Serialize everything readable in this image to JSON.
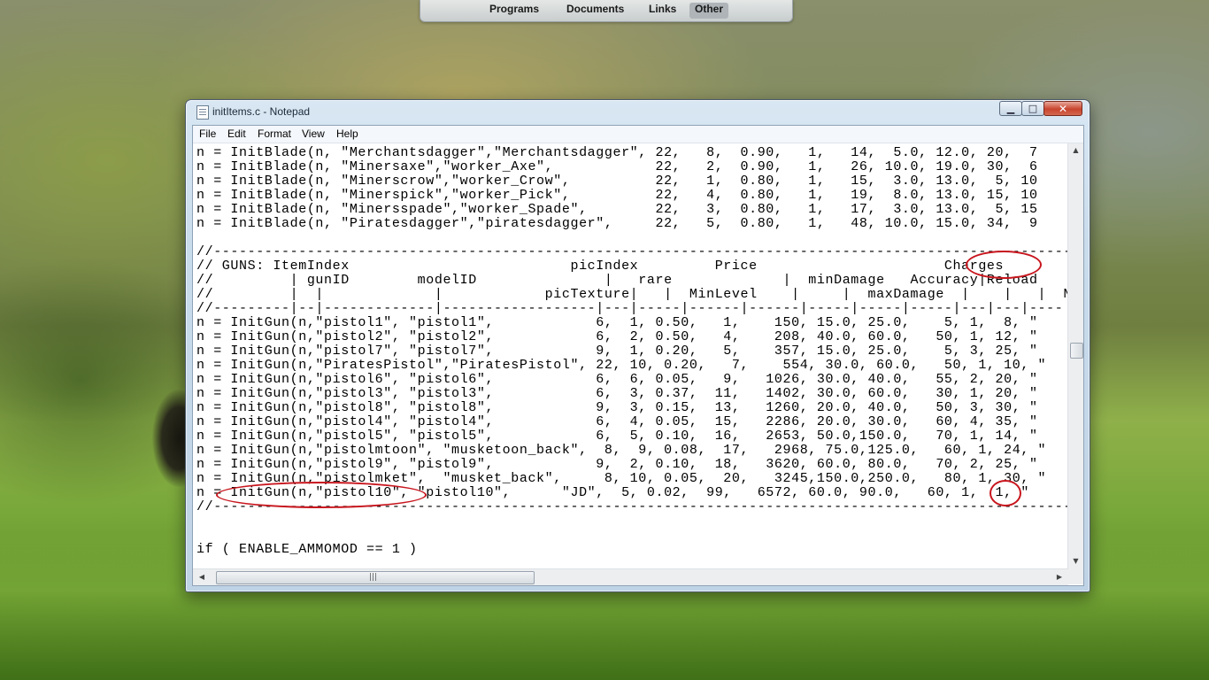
{
  "launcher": {
    "tabs": [
      {
        "label": "Programs",
        "active": false
      },
      {
        "label": "Documents",
        "active": false
      },
      {
        "label": "Links",
        "active": false
      },
      {
        "label": "Other",
        "active": true
      }
    ]
  },
  "window": {
    "title": "initItems.c - Notepad",
    "icon": "notepad-icon",
    "buttons": {
      "minimize": "minimize-icon",
      "maximize": "maximize-icon",
      "close": "close-icon"
    }
  },
  "menu": {
    "items": [
      "File",
      "Edit",
      "Format",
      "View",
      "Help"
    ]
  },
  "editor": {
    "lines": [
      "n = InitBlade(n, \"Merchantsdagger\",\"Merchantsdagger\", 22,   8,  0.90,   1,   14,  5.0, 12.0, 20,  7",
      "n = InitBlade(n, \"Minersaxe\",\"worker_Axe\",            22,   2,  0.90,   1,   26, 10.0, 19.0, 30,  6",
      "n = InitBlade(n, \"Minerscrow\",\"worker_Crow\",          22,   1,  0.80,   1,   15,  3.0, 13.0,  5, 10",
      "n = InitBlade(n, \"Minerspick\",\"worker_Pick\",          22,   4,  0.80,   1,   19,  8.0, 13.0, 15, 10",
      "n = InitBlade(n, \"Minersspade\",\"worker_Spade\",        22,   3,  0.80,   1,   17,  3.0, 13.0,  5, 15",
      "n = InitBlade(n, \"Piratesdagger\",\"piratesdagger\",     22,   5,  0.80,   1,   48, 10.0, 15.0, 34,  9",
      "",
      "//------------------------------------------------------------------------------------------------------",
      "// GUNS: ItemIndex                          picIndex         Price                      Charges",
      "//         | gunID        modelID               |   rare             |  minDamage   Accuracy|Reload",
      "//         |  |             |            picTexture|   |  MinLevel    |     |  maxDamage  |    |   |  Na",
      "//---------|--|-------------|------------------|---|-----|------|------|-----|-----|-----|---|---|----",
      "n = InitGun(n,\"pistol1\", \"pistol1\",            6,  1, 0.50,   1,    150, 15.0, 25.0,    5, 1,  8, \"",
      "n = InitGun(n,\"pistol2\", \"pistol2\",            6,  2, 0.50,   4,    208, 40.0, 60.0,   50, 1, 12, \"",
      "n = InitGun(n,\"pistol7\", \"pistol7\",            9,  1, 0.20,   5,    357, 15.0, 25.0,    5, 3, 25, \"",
      "n = InitGun(n,\"PiratesPistol\",\"PiratesPistol\", 22, 10, 0.20,   7,    554, 30.0, 60.0,   50, 1, 10, \"",
      "n = InitGun(n,\"pistol6\", \"pistol6\",            6,  6, 0.05,   9,   1026, 30.0, 40.0,   55, 2, 20, \"",
      "n = InitGun(n,\"pistol3\", \"pistol3\",            6,  3, 0.37,  11,   1402, 30.0, 60.0,   30, 1, 20, \"",
      "n = InitGun(n,\"pistol8\", \"pistol8\",            9,  3, 0.15,  13,   1260, 20.0, 40.0,   50, 3, 30, \"",
      "n = InitGun(n,\"pistol4\", \"pistol4\",            6,  4, 0.05,  15,   2286, 20.0, 30.0,   60, 4, 35, \"",
      "n = InitGun(n,\"pistol5\", \"pistol5\",            6,  5, 0.10,  16,   2653, 50.0,150.0,   70, 1, 14, \"",
      "n = InitGun(n,\"pistolmtoon\", \"musketoon_back\",  8,  9, 0.08,  17,   2968, 75.0,125.0,   60, 1, 24, \"",
      "n = InitGun(n,\"pistol9\", \"pistol9\",            9,  2, 0.10,  18,   3620, 60.0, 80.0,   70, 2, 25, \"",
      "n = InitGun(n,\"pistolmket\",  \"musket_back\",     8, 10, 0.05,  20,   3245,150.0,250.0,   80, 1, 30, \"",
      "n = InitGun(n,\"pistol10\", \"pistol10\",      \"JD\",  5, 0.02,  99,   6572, 60.0, 90.0,   60, 1,  1, \"",
      "//------------------------------------------------------------------------------------------------------",
      "",
      "",
      "if ( ENABLE_AMMOMOD == 1 )"
    ]
  },
  "annotation_color": "#c8161e"
}
